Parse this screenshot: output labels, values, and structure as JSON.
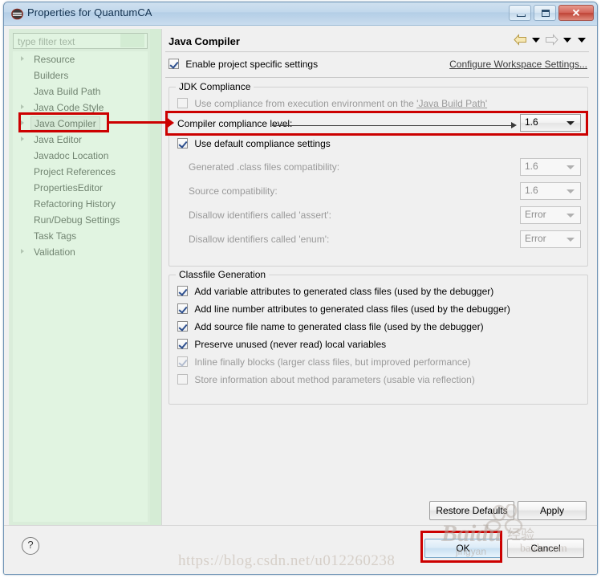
{
  "window": {
    "title": "Properties for QuantumCA",
    "app_icon": "eclipse-icon",
    "controls": {
      "minimize": "minimize-button",
      "maximize": "maximize-button",
      "close": "close-button",
      "close_glyph": "✕"
    }
  },
  "sidebar": {
    "filter": {
      "placeholder": "type filter text",
      "value": ""
    },
    "items": [
      {
        "label": "Resource",
        "expandable": true,
        "selected": false
      },
      {
        "label": "Builders",
        "expandable": false,
        "selected": false
      },
      {
        "label": "Java Build Path",
        "expandable": false,
        "selected": false
      },
      {
        "label": "Java Code Style",
        "expandable": true,
        "selected": false
      },
      {
        "label": "Java Compiler",
        "expandable": true,
        "selected": true
      },
      {
        "label": "Java Editor",
        "expandable": true,
        "selected": false
      },
      {
        "label": "Javadoc Location",
        "expandable": false,
        "selected": false
      },
      {
        "label": "Project References",
        "expandable": false,
        "selected": false
      },
      {
        "label": "PropertiesEditor",
        "expandable": false,
        "selected": false
      },
      {
        "label": "Refactoring History",
        "expandable": false,
        "selected": false
      },
      {
        "label": "Run/Debug Settings",
        "expandable": false,
        "selected": false
      },
      {
        "label": "Task Tags",
        "expandable": false,
        "selected": false
      },
      {
        "label": "Validation",
        "expandable": true,
        "selected": false
      }
    ]
  },
  "page": {
    "title": "Java Compiler",
    "nav": {
      "back_icon": "back-arrow-icon",
      "back_menu_icon": "chevron-down-icon",
      "forward_icon": "forward-arrow-icon",
      "forward_menu_icon": "chevron-down-icon",
      "more_icon": "chevron-down-icon"
    },
    "enable_project_specific": {
      "label": "Enable project specific settings",
      "checked": true
    },
    "configure_workspace_link": "Configure Workspace Settings...",
    "jdk_compliance": {
      "legend": "JDK Compliance",
      "use_execution_env": {
        "label_prefix": "Use compliance from execution environment on the ",
        "label_link": "'Java Build Path'",
        "checked": false,
        "enabled": false
      },
      "compiler_compliance_level": {
        "label": "Compiler compliance level:",
        "value": "1.6",
        "enabled": true
      },
      "use_default_compliance": {
        "label": "Use default compliance settings",
        "checked": true,
        "enabled": true
      },
      "rows": [
        {
          "label": "Generated .class files compatibility:",
          "value": "1.6",
          "enabled": false
        },
        {
          "label": "Source compatibility:",
          "value": "1.6",
          "enabled": false
        },
        {
          "label": "Disallow identifiers called 'assert':",
          "value": "Error",
          "enabled": false
        },
        {
          "label": "Disallow identifiers called 'enum':",
          "value": "Error",
          "enabled": false
        }
      ]
    },
    "classfile_generation": {
      "legend": "Classfile Generation",
      "items": [
        {
          "label": "Add variable attributes to generated class files (used by the debugger)",
          "checked": true,
          "enabled": true
        },
        {
          "label": "Add line number attributes to generated class files (used by the debugger)",
          "checked": true,
          "enabled": true
        },
        {
          "label": "Add source file name to generated class file (used by the debugger)",
          "checked": true,
          "enabled": true
        },
        {
          "label": "Preserve unused (never read) local variables",
          "checked": true,
          "enabled": true
        },
        {
          "label": "Inline finally blocks (larger class files, but improved performance)",
          "checked": true,
          "enabled": false
        },
        {
          "label": "Store information about method parameters (usable via reflection)",
          "checked": false,
          "enabled": false
        }
      ]
    },
    "buttons": {
      "restore_defaults": "Restore Defaults",
      "apply": "Apply"
    }
  },
  "footer": {
    "help_icon": "question-mark-icon",
    "help_glyph": "?",
    "ok": "OK",
    "cancel": "Cancel"
  },
  "annotations": {
    "color": "#cc0000",
    "highlight_sidebar_item": "Java Compiler",
    "highlight_compliance_row": "Compiler compliance level:",
    "highlight_ok_button": "OK"
  },
  "watermark": {
    "url": "https://blog.csdn.net/u012260238",
    "brand": "Baidu",
    "brand_sub": "jingyan",
    "brand_domain": "baidu.com",
    "brand_cn": "经验"
  }
}
